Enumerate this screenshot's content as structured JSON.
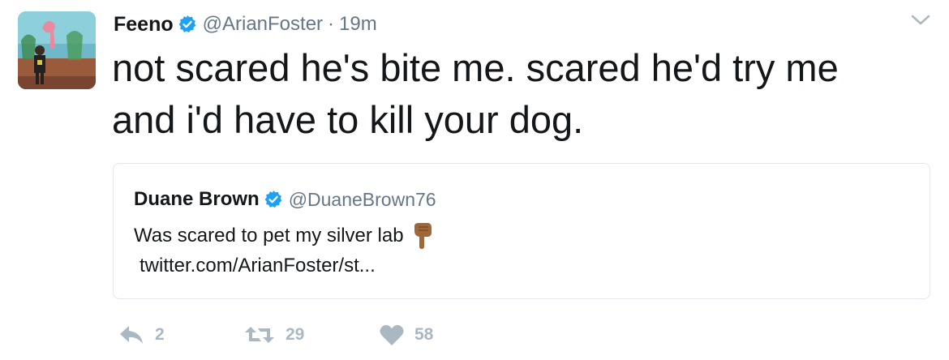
{
  "tweet": {
    "author": {
      "name": "Feeno",
      "handle": "@ArianFoster"
    },
    "separator": "·",
    "time": "19m",
    "text": "not scared he's bite me. scared he'd try me\nand i'd have to kill your dog.",
    "quoted": {
      "name": "Duane Brown",
      "handle": "@DuaneBrown76",
      "text": "Was scared to pet my silver lab",
      "emoji": "pointing-down-hand",
      "link": "twitter.com/ArianFoster/st..."
    },
    "actions": {
      "replies": "2",
      "retweets": "29",
      "likes": "58"
    }
  },
  "colors": {
    "text": "#14171a",
    "secondary": "#657786",
    "verified": "#1da1f2",
    "action": "#aab8c2",
    "border": "#e1e8ed"
  },
  "icons": [
    "verified-badge-icon",
    "chevron-down-icon",
    "reply-icon",
    "retweet-icon",
    "heart-icon",
    "pointing-down-emoji"
  ]
}
